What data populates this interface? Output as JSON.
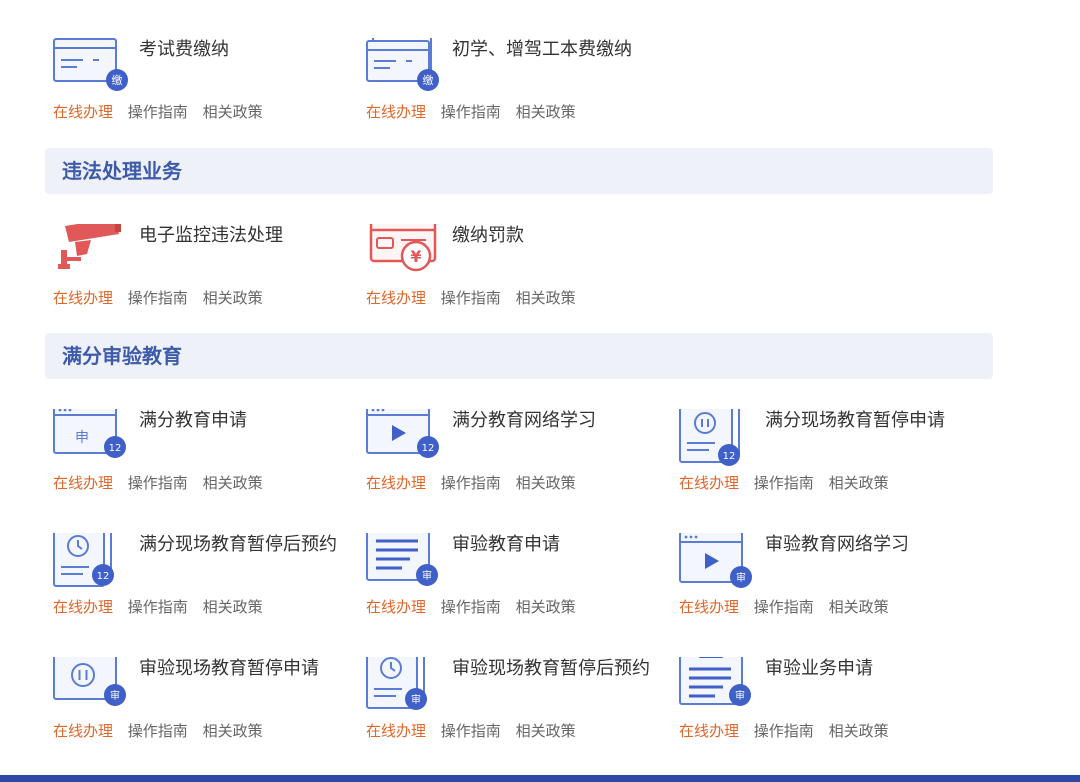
{
  "colors": {
    "accent_orange": "#e0672a",
    "section_title": "#3d5ba9",
    "section_bg": "#eef1f8",
    "icon_blue": "#5b7cd4",
    "icon_red": "#e05858",
    "bottom_bar": "#2b4aa3"
  },
  "links": {
    "online": "在线办理",
    "guide": "操作指南",
    "policy": "相关政策"
  },
  "sections": {
    "violation": {
      "title": "违法处理业务"
    },
    "education": {
      "title": "满分审验教育"
    }
  },
  "items": [
    {
      "title": "考试费缴纳",
      "icon": "payment-card-icon",
      "badge": "缴"
    },
    {
      "title": "初学、增驾工本费缴纳",
      "icon": "payment-stack-icon",
      "badge": "缴"
    },
    {
      "title": "电子监控违法处理",
      "icon": "surveillance-camera-icon"
    },
    {
      "title": "缴纳罚款",
      "icon": "fine-payment-icon"
    },
    {
      "title": "满分教育申请",
      "icon": "application-window-icon",
      "badge": "12",
      "glyph": "申"
    },
    {
      "title": "满分教育网络学习",
      "icon": "video-window-icon",
      "badge": "12"
    },
    {
      "title": "满分现场教育暂停申请",
      "icon": "pause-stack-icon",
      "badge": "12"
    },
    {
      "title": "满分现场教育暂停后预约",
      "icon": "clock-stack-icon",
      "badge": "12"
    },
    {
      "title": "审验教育申请",
      "icon": "document-lines-icon",
      "badge": "审"
    },
    {
      "title": "审验教育网络学习",
      "icon": "video-window-icon",
      "badge": "审"
    },
    {
      "title": "审验现场教育暂停申请",
      "icon": "pause-window-icon",
      "badge": "审"
    },
    {
      "title": "审验现场教育暂停后预约",
      "icon": "clock-stack-icon",
      "badge": "审"
    },
    {
      "title": "审验业务申请",
      "icon": "clipboard-icon",
      "badge": "审"
    }
  ]
}
